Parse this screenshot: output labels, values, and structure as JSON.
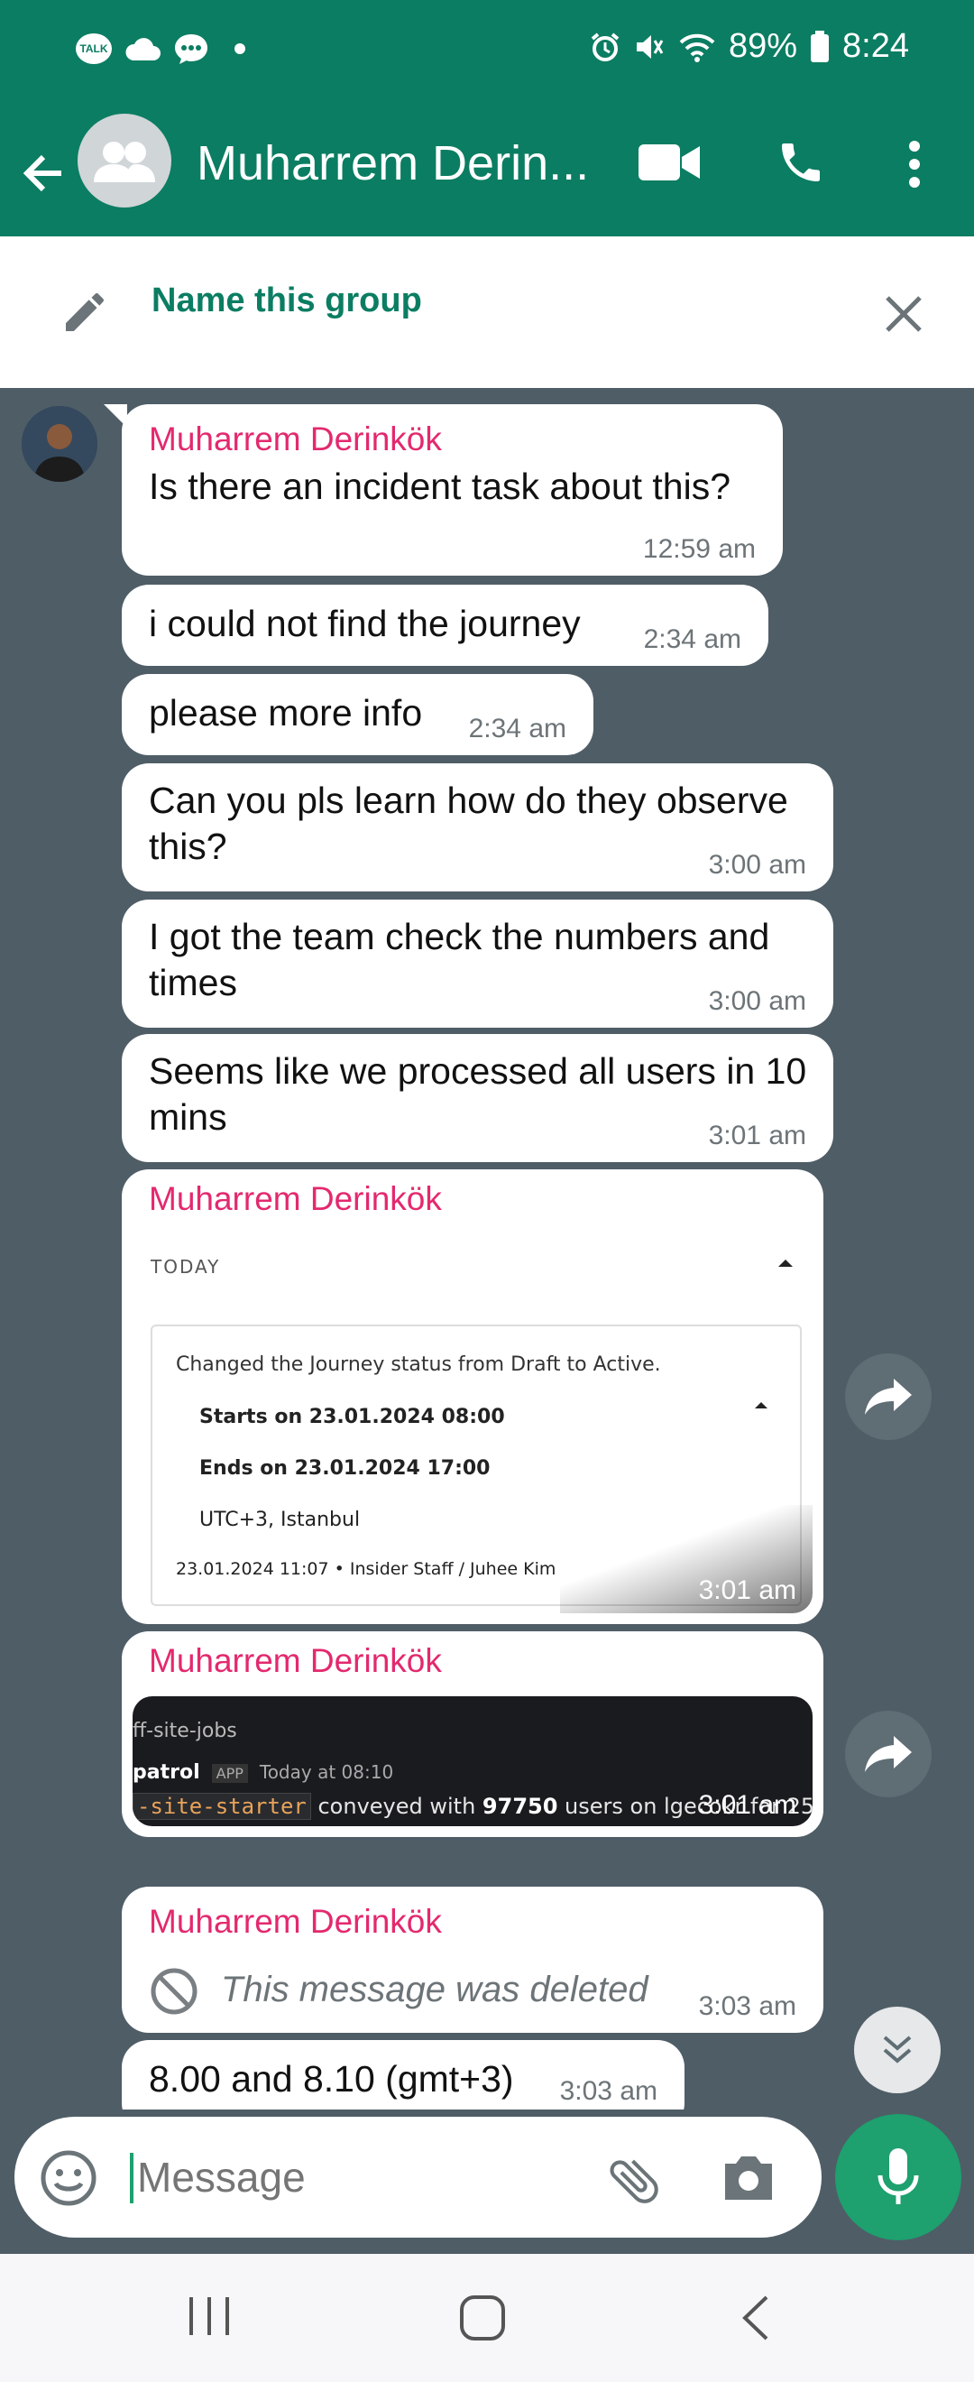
{
  "status_bar": {
    "battery": "89%",
    "time": "8:24",
    "talk_badge": "TALK"
  },
  "header": {
    "title": "Muharrem Derin...",
    "icons": [
      "back-arrow-icon",
      "group-avatar-icon",
      "video-call-icon",
      "phone-icon",
      "more-vert-icon"
    ]
  },
  "name_group": {
    "label": "Name this group"
  },
  "messages": [
    {
      "sender": "Muharrem Derinkök",
      "text": "Is there an incident task about this?",
      "time": "12:59 am"
    },
    {
      "text": "i could not find the journey",
      "time": "2:34 am"
    },
    {
      "text": "please more info",
      "time": "2:34 am"
    },
    {
      "text": "Can you pls learn how do they observe this?",
      "time": "3:00 am"
    },
    {
      "text": "I got the team check the numbers and times",
      "time": "3:00 am"
    },
    {
      "text": "Seems like we processed all users in 10 mins",
      "time": "3:01 am"
    },
    {
      "sender": "Muharrem Derinkök",
      "time": "3:01 am",
      "image": {
        "section": "TODAY",
        "headline": "Changed the Journey status from Draft to Active.",
        "starts": "Starts on 23.01.2024 08:00",
        "ends": "Ends on 23.01.2024 17:00",
        "tz": "UTC+3, Istanbul",
        "footer": "23.01.2024 11:07 • Insider Staff / Juhee Kim"
      }
    },
    {
      "sender": "Muharrem Derinkök",
      "time": "3:01 am",
      "image": {
        "channel": "ff-site-jobs",
        "bot": "patrol",
        "app": "APP",
        "when": "Today at 08:10",
        "code": "-site-starter",
        "text_pre": " conveyed with ",
        "count": "97750",
        "text_post": " users on lgecokr for 25"
      }
    },
    {
      "sender": "Muharrem Derinkök",
      "text": "This message was deleted",
      "time": "3:03 am"
    },
    {
      "text": "8.00 and 8.10 (gmt+3)",
      "time": "3:03 am"
    }
  ],
  "composer": {
    "placeholder": "Message"
  },
  "colors": {
    "header": "#0b7d62",
    "chat_bg": "#4f5d66",
    "sender": "#e3296e",
    "mic": "#1ea06f"
  }
}
